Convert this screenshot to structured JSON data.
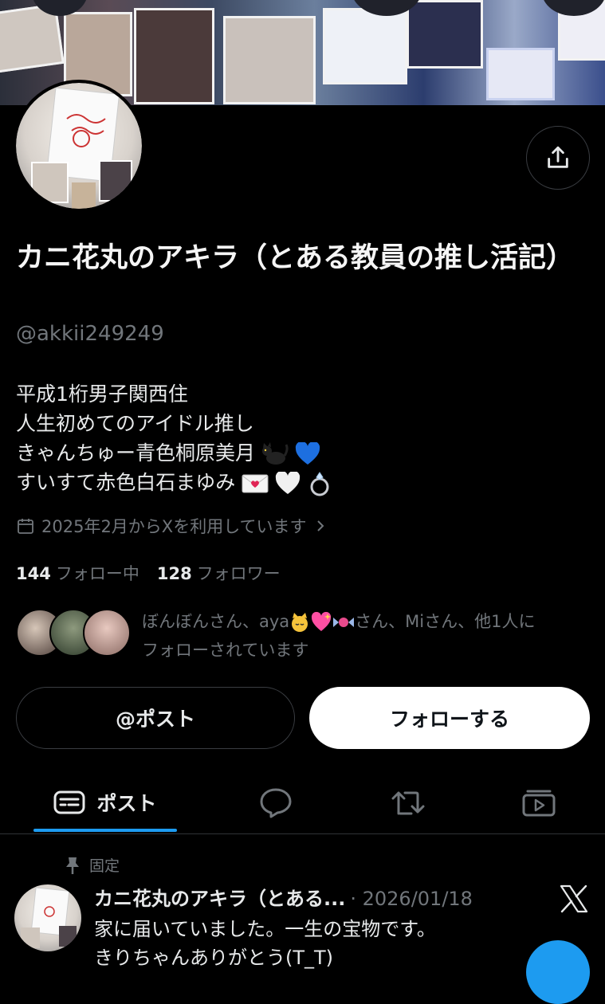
{
  "profile": {
    "display_name": "カニ花丸のアキラ（とある教員の推し活記）",
    "handle": "@akkii249249",
    "bio_lines": [
      "平成1桁男子関西住",
      "人生初めてのアイドル推し",
      "きゃんちゅー青色桐原美月",
      "すいすて赤色白石まゆみ"
    ],
    "bio_emojis": {
      "line3": [
        "black-cat-icon",
        "blue-heart-icon"
      ],
      "line4": [
        "love-letter-icon",
        "white-heart-icon",
        "ring-icon"
      ]
    },
    "joined": "2025年2月からXを利用しています",
    "following_count": "144",
    "following_label": "フォロー中",
    "followers_count": "128",
    "followers_label": "フォロワー",
    "followed_by_text_1": "ぼんぼんさん、aya",
    "followed_by_text_2": "さん、Miさん、他1人に",
    "followed_by_text_3": "フォローされています",
    "followed_by_emojis": [
      "cat-face-icon",
      "sparkling-heart-icon",
      "candy-icon"
    ]
  },
  "actions": {
    "post_label": "@ポスト",
    "follow_label": "フォローする"
  },
  "tabs": {
    "posts_label": "ポスト"
  },
  "pinned_tweet": {
    "pinned_label": "固定",
    "author": "カニ花丸のアキラ（とある...",
    "meta": "· 2026/01/18",
    "text_line1": "家に届いていました。一生の宝物です。",
    "text_line2": "きりちゃんありがとう(T_T)"
  },
  "colors": {
    "accent": "#1d9bf0",
    "muted": "#71767b",
    "text": "#e7e9ea",
    "background": "#000000"
  }
}
